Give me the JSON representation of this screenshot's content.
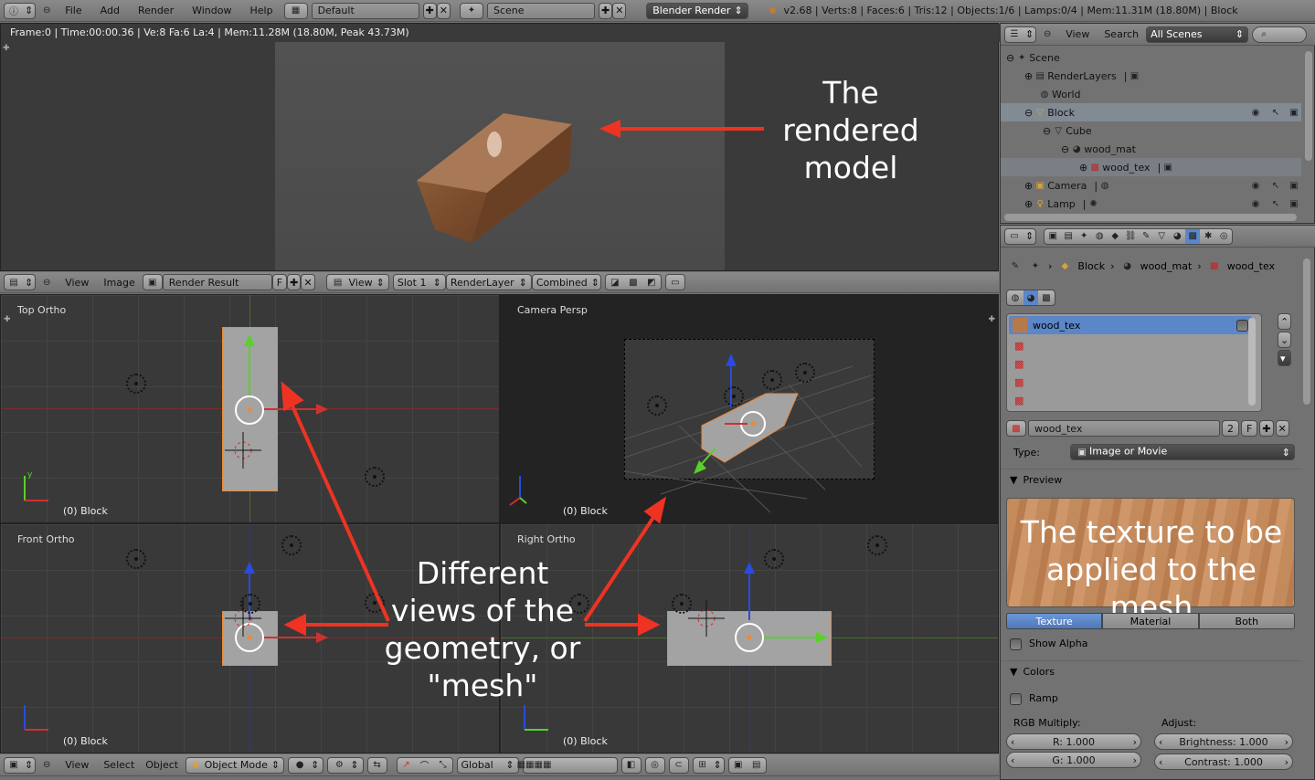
{
  "topbar": {
    "menus": [
      "File",
      "Add",
      "Render",
      "Window",
      "Help"
    ],
    "layout": "Default",
    "scene": "Scene",
    "engine": "Blender Render",
    "stats": "v2.68 | Verts:8 | Faces:6 | Tris:12 | Objects:1/6 | Lamps:0/4 | Mem:11.31M (18.80M) | Block"
  },
  "render_view": {
    "info": "Frame:0 | Time:00:00.36 | Ve:8 Fa:6 La:4 | Mem:11.28M (18.80M, Peak 43.73M)",
    "annotation": "The rendered model"
  },
  "image_header": {
    "view": "View",
    "image": "Image",
    "render_result": "Render Result",
    "f": "F",
    "view_sel": "View",
    "slot": "Slot 1",
    "layer": "RenderLayer",
    "pass": "Combined"
  },
  "viewports": {
    "top": {
      "label": "Top Ortho",
      "obj": "(0) Block"
    },
    "camera": {
      "label": "Camera Persp",
      "obj": "(0) Block"
    },
    "front": {
      "label": "Front Ortho",
      "obj": "(0) Block"
    },
    "right": {
      "label": "Right Ortho",
      "obj": "(0) Block"
    },
    "annotation": "Different views of the geometry, or \"mesh\""
  },
  "bottom_header": {
    "view": "View",
    "select": "Select",
    "object": "Object",
    "mode": "Object Mode",
    "orientation": "Global"
  },
  "outliner": {
    "view": "View",
    "search": "Search",
    "filter": "All Scenes",
    "items": [
      {
        "label": "Scene",
        "indent": 0
      },
      {
        "label": "RenderLayers",
        "indent": 1
      },
      {
        "label": "World",
        "indent": 1
      },
      {
        "label": "Block",
        "indent": 1
      },
      {
        "label": "Cube",
        "indent": 2
      },
      {
        "label": "wood_mat",
        "indent": 3
      },
      {
        "label": "wood_tex",
        "indent": 4
      },
      {
        "label": "Camera",
        "indent": 1
      },
      {
        "label": "Lamp",
        "indent": 1
      }
    ]
  },
  "properties": {
    "breadcrumb": [
      "Block",
      "wood_mat",
      "wood_tex"
    ],
    "slot_name": "wood_tex",
    "tex_name": "wood_tex",
    "users": "2",
    "f": "F",
    "type_label": "Type:",
    "type_value": "Image or Movie",
    "preview_label": "Preview",
    "preview_annotation": "The texture to be applied to the mesh",
    "tabs": [
      "Texture",
      "Material",
      "Both"
    ],
    "show_alpha": "Show Alpha",
    "colors_label": "Colors",
    "ramp": "Ramp",
    "rgb_multiply": "RGB Multiply:",
    "adjust": "Adjust:",
    "r": "R: 1.000",
    "g": "G: 1.000",
    "brightness": "Brightness: 1.000",
    "contrast": "Contrast: 1.000"
  }
}
